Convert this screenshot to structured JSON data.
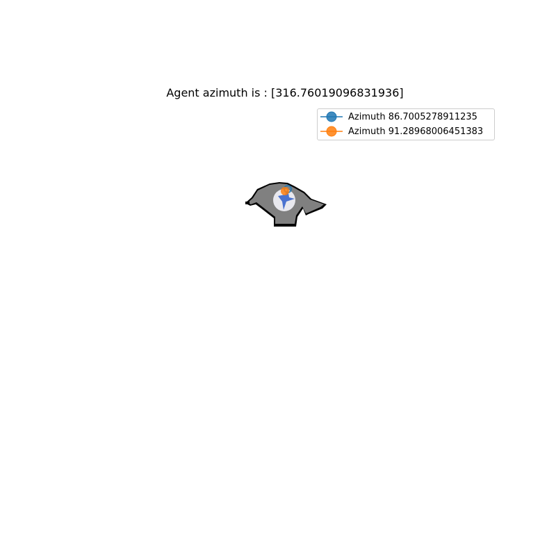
{
  "title": "Agent azimuth is : [316.76019096831936]",
  "legend": {
    "items": [
      {
        "label": "Azimuth 86.7005278911235",
        "color": "#1f77b4"
      },
      {
        "label": "Azimuth 91.28968006451383",
        "color": "#ff7f0e"
      }
    ]
  },
  "map": {
    "floor_color": "#808080",
    "wall_color": "#000000",
    "agent_color": "#4a72d0",
    "agent_halo_color": "#e8e8ee",
    "agent_azimuth_deg": 316.76019096831936
  }
}
